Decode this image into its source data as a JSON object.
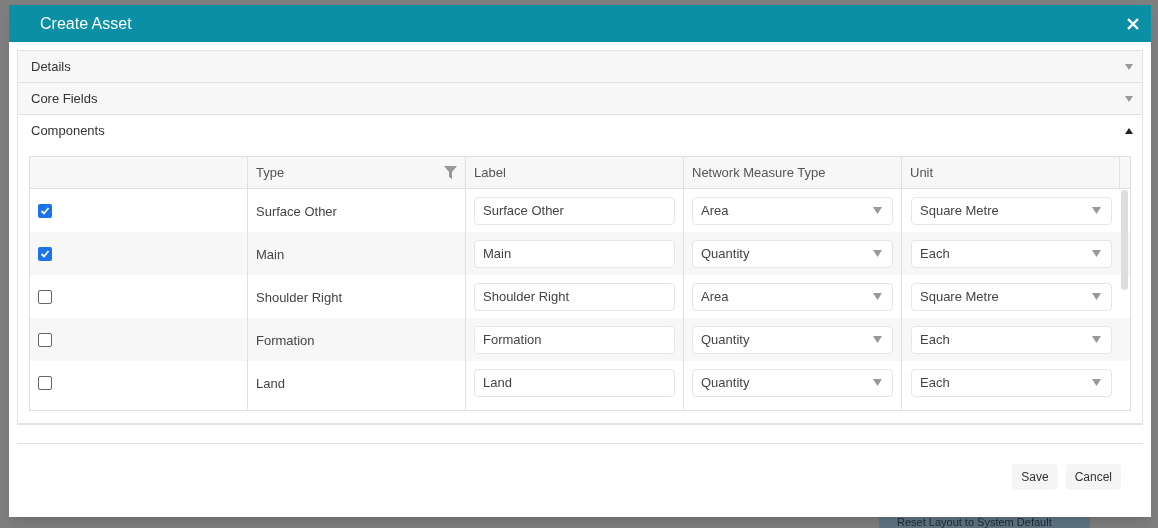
{
  "background": {
    "button": "Reset Layout to System Default"
  },
  "dialog": {
    "title": "Create Asset",
    "sections": [
      {
        "title": "Details",
        "expanded": false
      },
      {
        "title": "Core Fields",
        "expanded": false
      },
      {
        "title": "Components",
        "expanded": true
      }
    ],
    "table": {
      "columns": [
        "Type",
        "Label",
        "Network Measure Type",
        "Unit"
      ],
      "rows": [
        {
          "checked": true,
          "type": "Surface Other",
          "label": "Surface Other",
          "measure": "Area",
          "unit": "Square Metre"
        },
        {
          "checked": true,
          "type": "Main",
          "label": "Main",
          "measure": "Quantity",
          "unit": "Each"
        },
        {
          "checked": false,
          "type": "Shoulder Right",
          "label": "Shoulder Right",
          "measure": "Area",
          "unit": "Square Metre"
        },
        {
          "checked": false,
          "type": "Formation",
          "label": "Formation",
          "measure": "Quantity",
          "unit": "Each"
        },
        {
          "checked": false,
          "type": "Land",
          "label": "Land",
          "measure": "Quantity",
          "unit": "Each"
        }
      ]
    },
    "buttons": [
      "Save",
      "Cancel"
    ]
  }
}
